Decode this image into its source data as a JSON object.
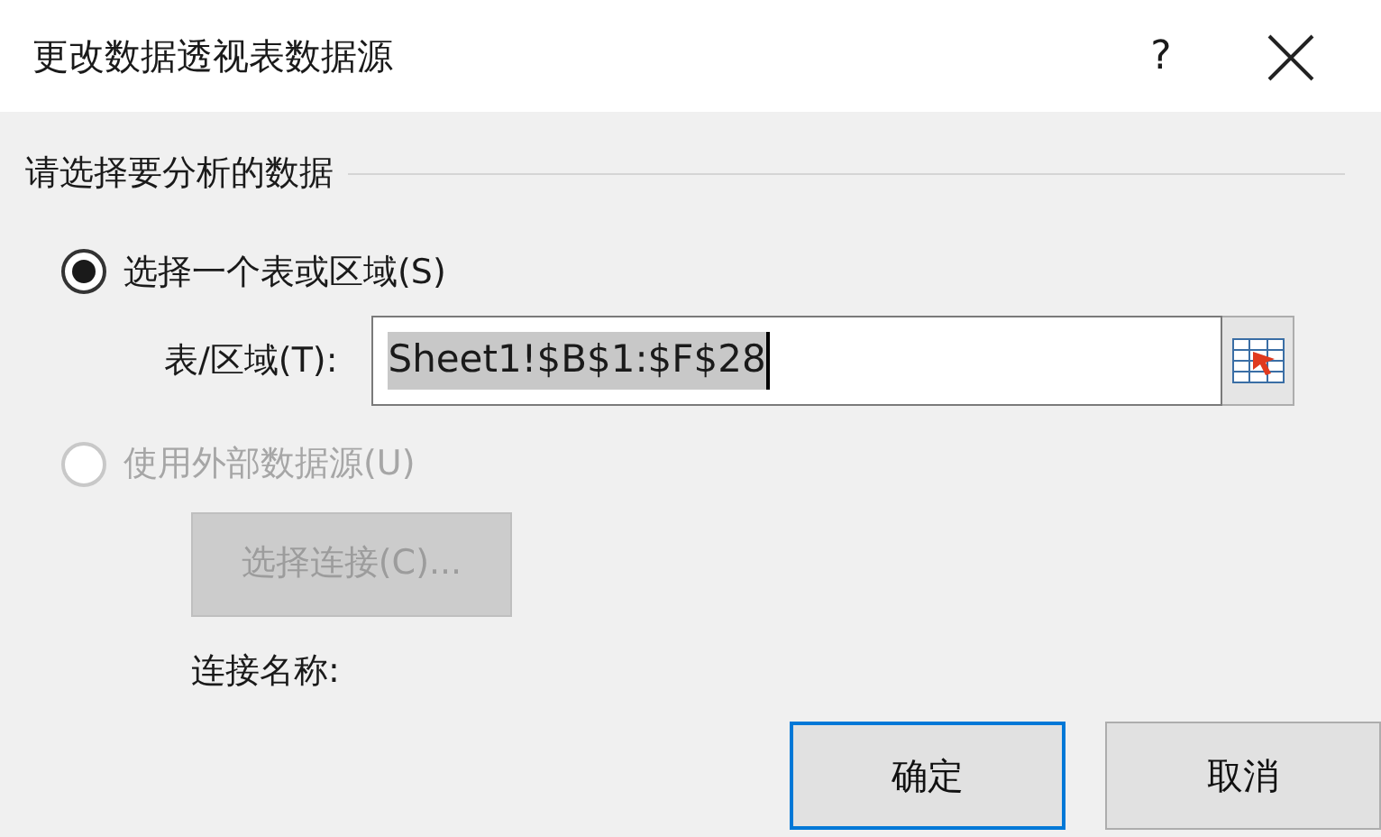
{
  "window": {
    "title": "更改数据透视表数据源",
    "help": "?"
  },
  "section": {
    "title": "请选择要分析的数据"
  },
  "options": [
    {
      "label": "选择一个表或区域(S)",
      "selected": true,
      "disabled": false
    },
    {
      "label": "使用外部数据源(U)",
      "selected": false,
      "disabled": true
    }
  ],
  "range_field": {
    "label": "表/区域(T):",
    "value": "Sheet1!$B$1:$F$28",
    "highlighted": true
  },
  "connection": {
    "button": "选择连接(C)...",
    "disabled": true,
    "name_label": "连接名称:"
  },
  "buttons": [
    {
      "label": "确定",
      "default": true
    },
    {
      "label": "取消",
      "default": false
    }
  ]
}
